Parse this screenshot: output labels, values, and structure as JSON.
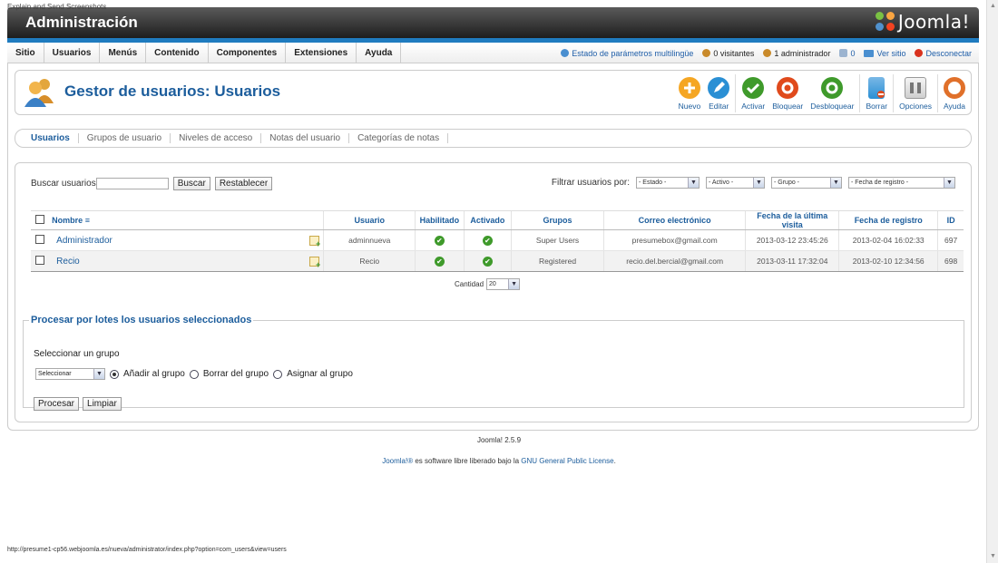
{
  "window_caption": "Explain and Send Screenshots",
  "header": {
    "title": "Administración",
    "logo_text": "Joomla!"
  },
  "menu": [
    "Sitio",
    "Usuarios",
    "Menús",
    "Contenido",
    "Componentes",
    "Extensiones",
    "Ayuda"
  ],
  "status": {
    "multilang": "Estado de parámetros multilingüe",
    "visitors": "0 visitantes",
    "admins": "1 administrador",
    "messages": "0",
    "view_site": "Ver sitio",
    "logout": "Desconectar"
  },
  "page_title": "Gestor de usuarios: Usuarios",
  "toolbar": [
    {
      "label": "Nuevo",
      "icon": "new-icon",
      "color": "#f5a623"
    },
    {
      "label": "Editar",
      "icon": "edit-icon",
      "color": "#2a8fd4"
    },
    {
      "label": "Activar",
      "icon": "activate-icon",
      "color": "#3f9a2b"
    },
    {
      "label": "Bloquear",
      "icon": "block-icon",
      "color": "#e04a1c"
    },
    {
      "label": "Desbloquear",
      "icon": "unblock-icon",
      "color": "#3f9a2b"
    },
    {
      "label": "Borrar",
      "icon": "trash-icon",
      "color": "#2a8fd4"
    },
    {
      "label": "Opciones",
      "icon": "options-icon",
      "color": "#888888"
    },
    {
      "label": "Ayuda",
      "icon": "help-icon",
      "color": "#e0702a"
    }
  ],
  "subnav": [
    "Usuarios",
    "Grupos de usuario",
    "Niveles de acceso",
    "Notas del usuario",
    "Categorías de notas"
  ],
  "search": {
    "label": "Buscar usuarios",
    "value": "",
    "search_btn": "Buscar",
    "reset_btn": "Restablecer"
  },
  "filters": {
    "label": "Filtrar usuarios por:",
    "state": "- Estado -",
    "active": "- Activo -",
    "group": "- Grupo -",
    "date": "- Fecha de registro -"
  },
  "table": {
    "headers": {
      "name": "Nombre",
      "username": "Usuario",
      "enabled": "Habilitado",
      "activated": "Activado",
      "groups": "Grupos",
      "email": "Correo electrónico",
      "last_visit": "Fecha de la última visita",
      "registered": "Fecha de registro",
      "id": "ID"
    },
    "rows": [
      {
        "name": "Administrador",
        "username": "adminnueva",
        "groups": "Super Users",
        "email": "presumebox@gmail.com",
        "last_visit": "2013-03-12 23:45:26",
        "registered": "2013-02-04 16:02:33",
        "id": "697"
      },
      {
        "name": "Recio",
        "username": "Recio",
        "groups": "Registered",
        "email": "recio.del.bercial@gmail.com",
        "last_visit": "2013-03-11 17:32:04",
        "registered": "2013-02-10 12:34:56",
        "id": "698"
      }
    ]
  },
  "pager": {
    "label": "Cantidad",
    "value": "20"
  },
  "batch": {
    "legend": "Procesar por lotes los usuarios seleccionados",
    "select_label": "Seleccionar un grupo",
    "select_value": "Seleccionar",
    "opt_add": "Añadir al grupo",
    "opt_remove": "Borrar del grupo",
    "opt_set": "Asignar al grupo",
    "process_btn": "Procesar",
    "clear_btn": "Limpiar"
  },
  "footer": {
    "version": "Joomla! 2.5.9",
    "lic_prefix": "Joomla!®",
    "lic_mid": " es software libre liberado bajo la ",
    "lic_link": "GNU General Public License",
    "lic_end": "."
  },
  "statusbar": "http://presume1-cp56.webjoomla.es/nueva/administrator/index.php?option=com_users&view=users"
}
